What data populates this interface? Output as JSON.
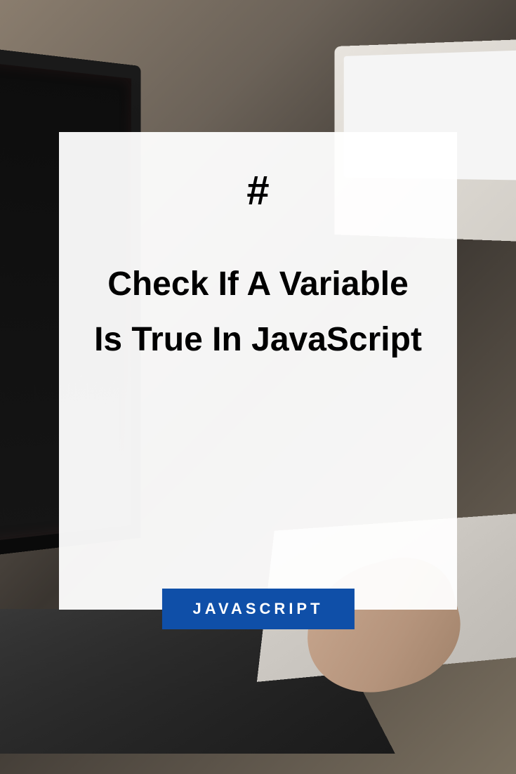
{
  "card": {
    "symbol": "#",
    "title": "Check If A Variable Is True In JavaScript",
    "tag": "JAVASCRIPT"
  },
  "colors": {
    "badge_bg": "#0f4fa8",
    "badge_text": "#ffffff",
    "card_bg": "rgba(255,255,255,0.95)",
    "text": "#000000"
  }
}
